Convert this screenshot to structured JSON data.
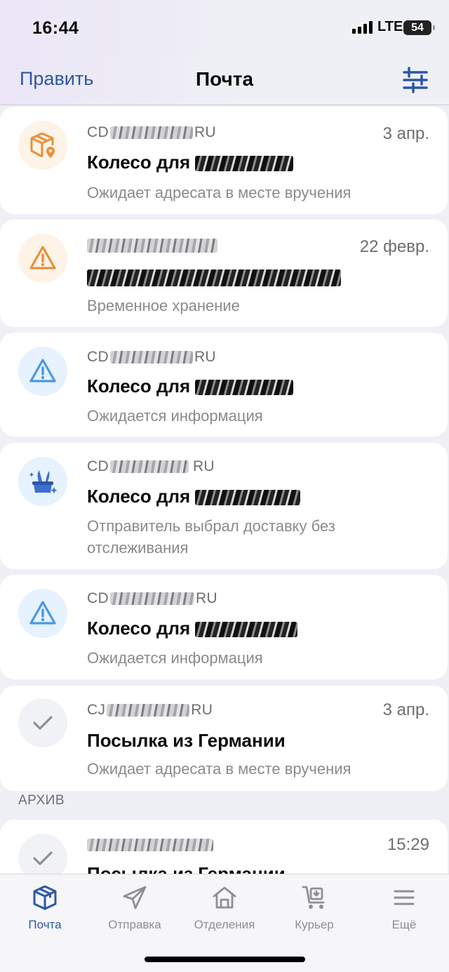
{
  "status_bar": {
    "time": "16:44",
    "network": "LTE",
    "battery": "54"
  },
  "navbar": {
    "edit_label": "Править",
    "title": "Почта",
    "filter_icon": "sliders-icon"
  },
  "items": [
    {
      "track": "CD",
      "track_end": "RU",
      "date": "3 апр.",
      "title": "Колесо для",
      "status": "Ожидает адресата в месте вручения",
      "icon": "package-pin-icon"
    },
    {
      "track": "",
      "track_end": "",
      "date": "22 февр.",
      "title": "",
      "status": "Временное хранение",
      "icon": "warning-icon"
    },
    {
      "track": "CD",
      "track_end": "RU",
      "date": "",
      "title": "Колесо для",
      "status": "Ожидается информация",
      "icon": "warning-icon"
    },
    {
      "track": "CD",
      "track_end": "RU",
      "date": "",
      "title": "Колесо для",
      "status": "Отправитель выбрал доставку без отслеживания",
      "icon": "magic-hat-icon"
    },
    {
      "track": "CD",
      "track_end": "RU",
      "date": "",
      "title": "Колесо для",
      "status": "Ожидается информация",
      "icon": "warning-icon"
    },
    {
      "track": "CJ",
      "track_end": "RU",
      "date": "3 апр.",
      "title": "Посылка из Германии",
      "status": "Ожидает адресата в месте вручения",
      "icon": "check-icon"
    }
  ],
  "archive": {
    "label": "АРХИВ",
    "items": [
      {
        "date": "15:29",
        "title": "Посылка из Германии",
        "icon": "check-icon"
      }
    ]
  },
  "tabs": [
    {
      "label": "Почта",
      "icon": "box-icon",
      "active": true
    },
    {
      "label": "Отправка",
      "icon": "send-icon",
      "active": false
    },
    {
      "label": "Отделения",
      "icon": "house-icon",
      "active": false
    },
    {
      "label": "Курьер",
      "icon": "cart-icon",
      "active": false
    },
    {
      "label": "Ещё",
      "icon": "menu-icon",
      "active": false
    }
  ],
  "colors": {
    "accent": "#2d57a6",
    "orange": "#e8913a",
    "blue": "#4a98e6",
    "gray": "#8e8e93"
  }
}
